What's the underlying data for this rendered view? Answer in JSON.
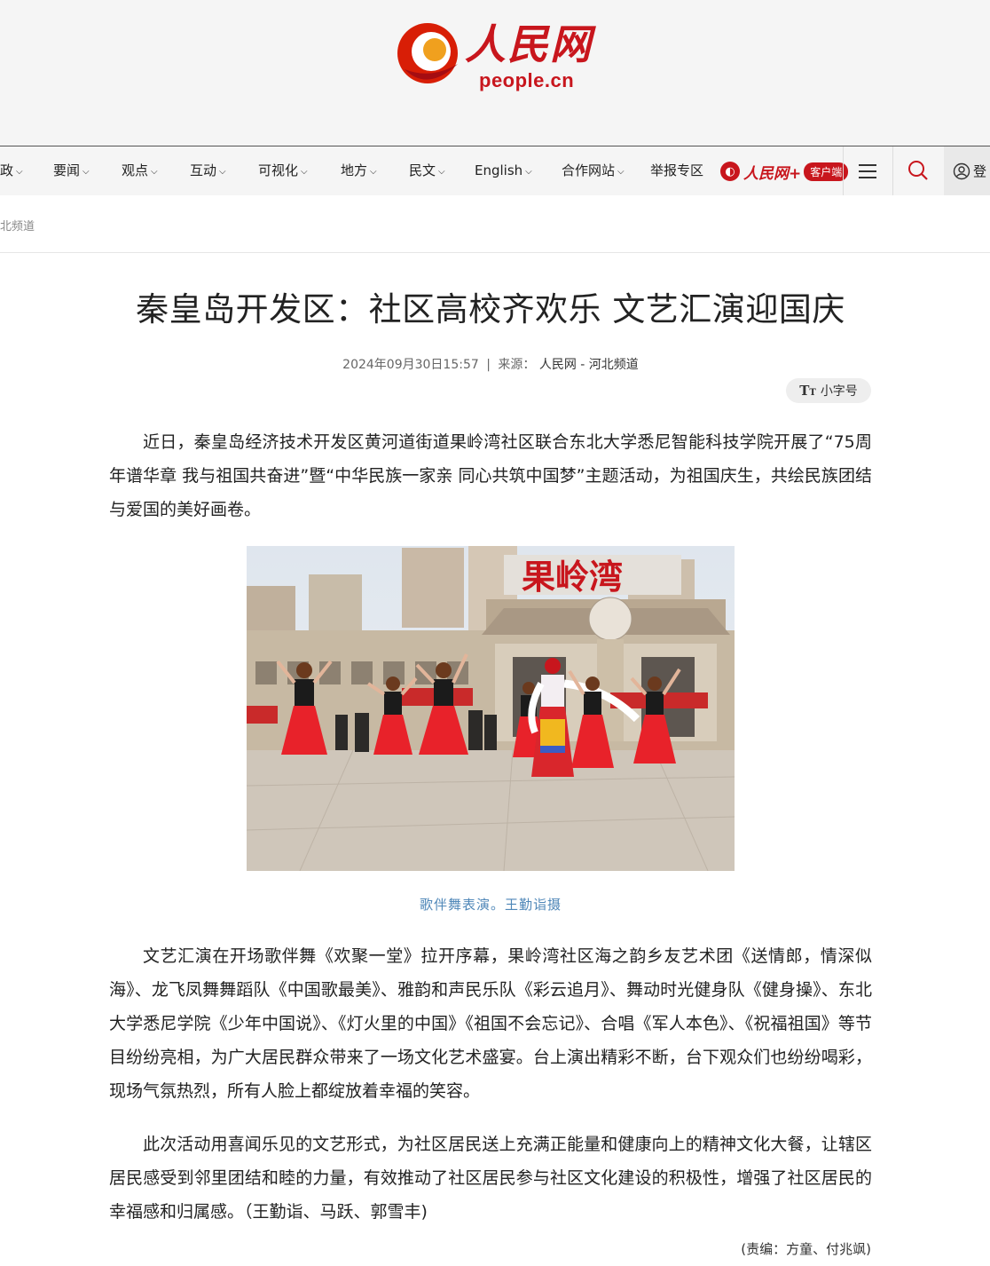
{
  "header": {
    "logo_cn": "人民网",
    "logo_url": "people.cn"
  },
  "nav": {
    "items": [
      {
        "label": "政"
      },
      {
        "label": "要闻"
      },
      {
        "label": "观点"
      },
      {
        "label": "互动"
      },
      {
        "label": "可视化"
      },
      {
        "label": "地方"
      },
      {
        "label": "民文"
      },
      {
        "label": "English"
      },
      {
        "label": "合作网站"
      }
    ],
    "report": "举报专区",
    "app_name": "人民网+",
    "app_pill": "客户端",
    "login": "登"
  },
  "breadcrumb": "北频道",
  "article": {
    "title": "秦皇岛开发区：社区高校齐欢乐 文艺汇演迎国庆",
    "date": "2024年09月30日15:57",
    "source_sep": "|",
    "source_label": "来源：",
    "source_name": "人民网 - 河北频道",
    "font_toggle": "小字号",
    "paragraphs": [
      "近日，秦皇岛经济技术开发区黄河道街道果岭湾社区联合东北大学悉尼智能科技学院开展了“75周年谱华章 我与祖国共奋进”暨“中华民族一家亲 同心共筑中国梦”主题活动，为祖国庆生，共绘民族团结与爱国的美好画卷。",
      "文艺汇演在开场歌伴舞《欢聚一堂》拉开序幕，果岭湾社区海之韵乡友艺术团《送情郎，情深似海》、龙飞凤舞舞蹈队《中国歌最美》、雅韵和声民乐队《彩云追月》、舞动时光健身队《健身操》、东北大学悉尼学院《少年中国说》、《灯火里的中国》《祖国不会忘记》、合唱《军人本色》、《祝福祖国》等节目纷纷亮相，为广大居民群众带来了一场文化艺术盛宴。台上演出精彩不断，台下观众们也纷纷喝彩，现场气氛热烈，所有人脸上都绽放着幸福的笑容。",
      "此次活动用喜闻乐见的文艺形式，为社区居民送上充满正能量和健康向上的精神文化大餐，让辖区居民感受到邻里团结和睦的力量，有效推动了社区居民参与社区文化建设的积极性，增强了社区居民的幸福感和归属感。（王勤诣、马跃、郭雪丰)"
    ],
    "photo_sign": "果岭湾",
    "caption": "歌伴舞表演。王勤诣摄",
    "editor": "(责编：方童、付兆飒)"
  },
  "colors": {
    "brand_red": "#c8161d",
    "caption_blue": "#4f87b8",
    "header_bg": "#f5f5f5"
  },
  "icons": {
    "menu": "hamburger-icon",
    "search": "search-icon",
    "user": "user-icon"
  }
}
